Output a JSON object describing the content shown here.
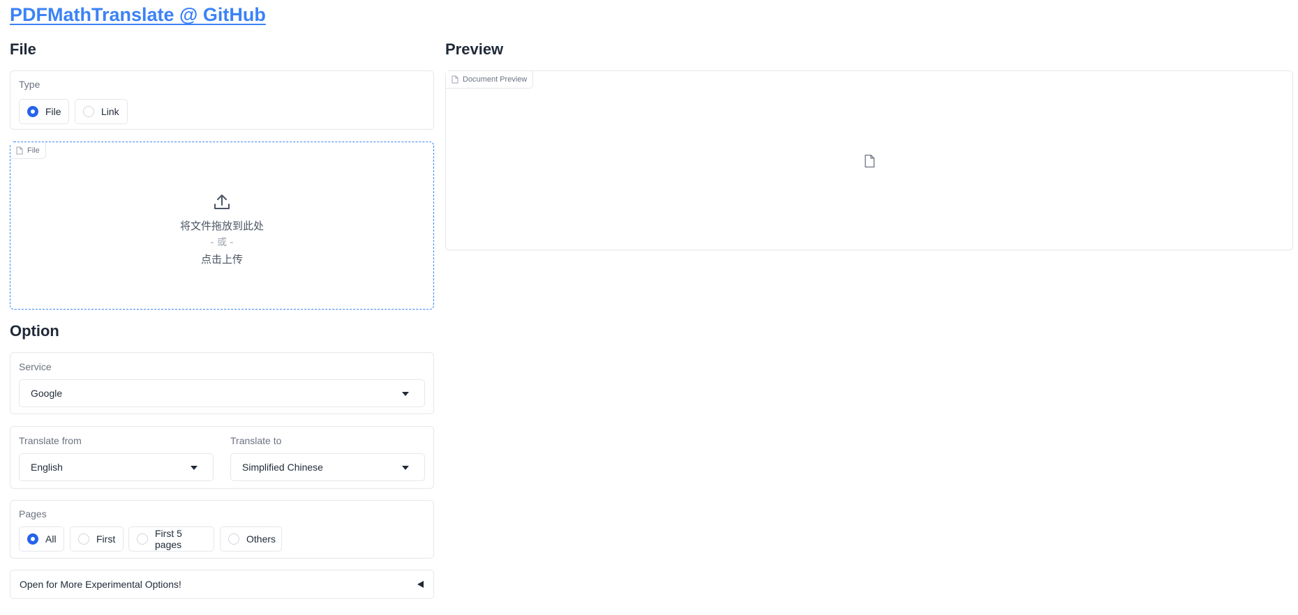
{
  "header": {
    "title": "PDFMathTranslate @ GitHub"
  },
  "file_section": {
    "title": "File",
    "type_label": "Type",
    "type_options": [
      "File",
      "Link"
    ],
    "type_selected": "File",
    "upload": {
      "chip_label": "File",
      "drop_text": "将文件拖放到此处",
      "or_text": "- 或 -",
      "click_text": "点击上传"
    }
  },
  "option_section": {
    "title": "Option",
    "service_label": "Service",
    "service_value": "Google",
    "from_label": "Translate from",
    "from_value": "English",
    "to_label": "Translate to",
    "to_value": "Simplified Chinese",
    "pages_label": "Pages",
    "pages_options": [
      "All",
      "First",
      "First 5 pages",
      "Others"
    ],
    "pages_selected": "All",
    "experimental_label": "Open for More Experimental Options!"
  },
  "preview_section": {
    "title": "Preview",
    "chip_label": "Document Preview"
  },
  "colors": {
    "accent": "#2563eb",
    "link": "#3b82f6",
    "border": "#e5e7eb"
  },
  "icons": {
    "upload": "upload-icon",
    "file": "file-icon",
    "dropdown": "chevron-down-icon",
    "accordion": "triangle-left-icon"
  }
}
